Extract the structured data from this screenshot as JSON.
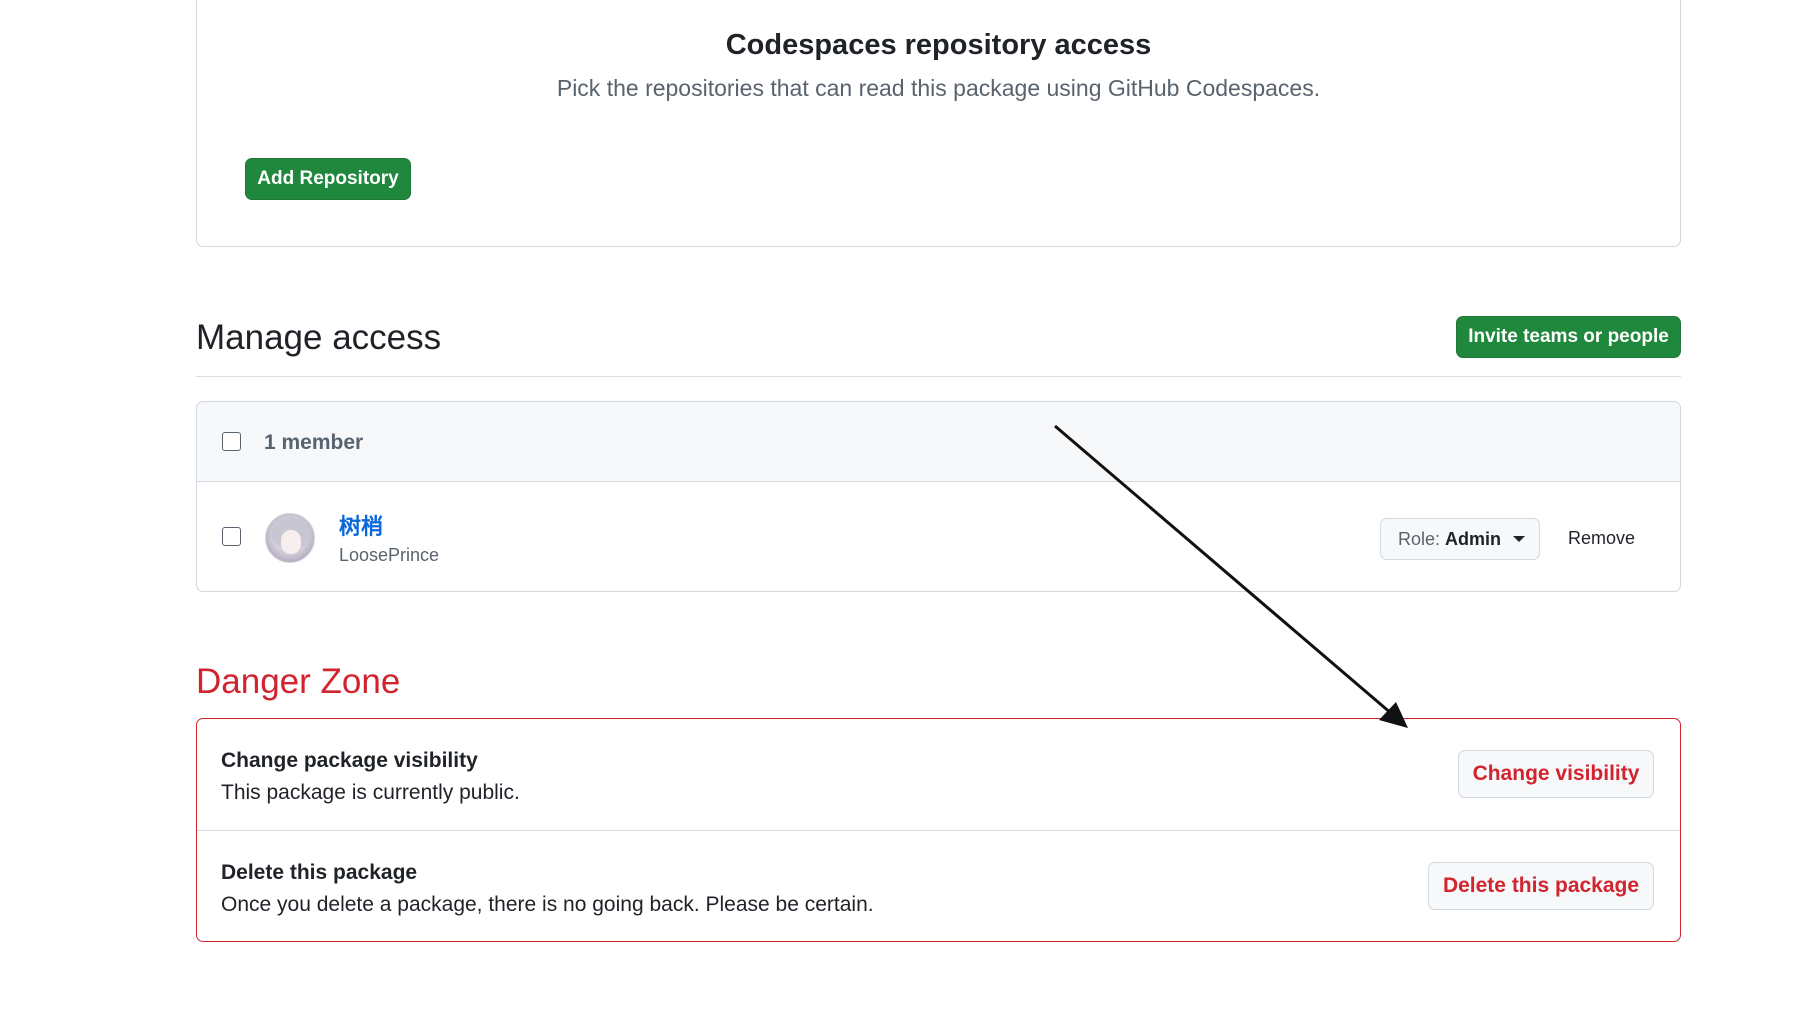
{
  "codespaces": {
    "title": "Codespaces repository access",
    "description": "Pick the repositories that can read this package using GitHub Codespaces.",
    "add_button_label": "Add Repository"
  },
  "manage_access": {
    "title": "Manage access",
    "invite_button_label": "Invite teams or people",
    "member_count_label": "1 member",
    "members": [
      {
        "display_name": "树梢",
        "username": "LoosePrince",
        "role_prefix": "Role:",
        "role_value": "Admin",
        "remove_label": "Remove"
      }
    ]
  },
  "danger_zone": {
    "title": "Danger Zone",
    "rows": [
      {
        "title": "Change package visibility",
        "description": "This package is currently public.",
        "button_label": "Change visibility"
      },
      {
        "title": "Delete this package",
        "description": "Once you delete a package, there is no going back. Please be certain.",
        "button_label": "Delete this package"
      }
    ]
  },
  "colors": {
    "primary_green": "#1f883d",
    "danger_red": "#d1242f",
    "link_blue": "#0969da",
    "border": "#d0d7de",
    "muted_text": "#59636e"
  }
}
